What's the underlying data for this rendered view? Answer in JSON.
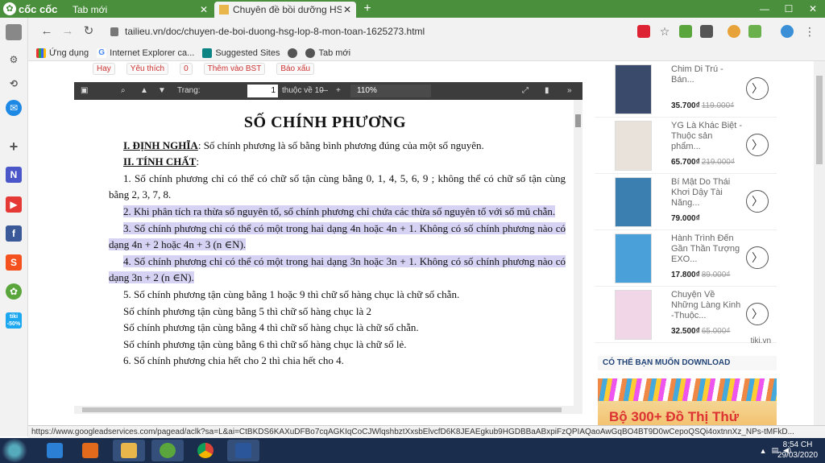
{
  "browser": {
    "brand": "cốc cốc",
    "tabs": [
      {
        "title": "Tab mới",
        "active": false
      },
      {
        "title": "Chuyên đề bồi dưỡng HSG lớp 8",
        "active": true
      }
    ],
    "new_tab": "+",
    "window_controls": {
      "minimize": "—",
      "maximize": "☐",
      "close": "✕"
    },
    "url": "tailieu.vn/doc/chuyen-de-boi-duong-hsg-lop-8-mon-toan-1625273.html",
    "bookmarks": [
      {
        "label": "Ứng dụng",
        "icon": "apps-grid-icon"
      },
      {
        "label": "Internet Explorer ca...",
        "icon": "google-icon"
      },
      {
        "label": "Suggested Sites",
        "icon": "bing-icon"
      },
      {
        "label": "",
        "icon": "globe-icon"
      },
      {
        "label": "Tab mới",
        "icon": "globe-icon"
      }
    ],
    "sidebar_icons": [
      "panel-icon",
      "settings-icon",
      "history-icon",
      "messenger-icon",
      "add-icon",
      "notion-icon",
      "youtube-icon",
      "facebook-icon",
      "shopee-icon",
      "coccoc-icon",
      "tiki-icon"
    ],
    "tiki_badge": "tiki\n-50%"
  },
  "page": {
    "social": [
      "Hay",
      "Yêu thích",
      "0",
      "Thêm vào BST",
      "Báo xấu"
    ],
    "pdf_toolbar": {
      "page_label": "Trang:",
      "page_value": "1",
      "page_of": "thuộc về 10",
      "zoom": "110%"
    },
    "doc": {
      "title": "SỐ CHÍNH PHƯƠNG",
      "def_label": "I. ĐỊNH NGHĨA",
      "def_text": ":  Số chính phương là số bằng bình phương đúng của một số nguyên.",
      "props_label": "II. TÍNH CHẤT",
      "props_colon": ":",
      "p1": "1. Số chính phương chỉ có thể có chữ số tận cùng bằng 0, 1, 4, 5, 6, 9 ; không thể có chữ số tận cùng bằng 2, 3, 7, 8.",
      "p2": "2. Khi phân tích ra thừa số nguyên tố, số chính phương chỉ chứa các thừa số nguyên tố với số mũ chẵn.",
      "p3": "3. Số chính phương chỉ có thể có một trong hai dạng 4n hoặc 4n + 1. Không có số chính phương nào có dạng 4n + 2 hoặc 4n + 3 (n ∈N).",
      "p4": "4. Số chính phương chỉ có thể có một trong hai dạng 3n hoặc 3n + 1. Không có số chính phương nào có dạng 3n + 2 (n ∈N).",
      "p5": "5. Số chính phương  tận cùng bằng 1 hoặc 9 thì chữ số hàng chục là chữ số chẵn.",
      "p5a": "Số chính phương tận cùng bằng 5 thì chữ số hàng chục là 2",
      "p5b": "Số chính phương tận cùng bằng 4 thì chữ số hàng chục là chữ số chẵn.",
      "p5c": "Số chính phương tận cùng bằng 6 thì chữ số hàng chục là chữ số lẻ.",
      "p6": "6. Số chính phương chia hết cho 2 thì chia hết cho 4."
    },
    "products": [
      {
        "name": "Chim Di Trú - Bán...",
        "price": "35.700₫",
        "old_price": "119.000₫",
        "color": "#3a4a6a"
      },
      {
        "name": "YG Là Khác Biệt -Thuộc sản phẩm...",
        "price": "65.700₫",
        "old_price": "219.000₫",
        "color": "#e8e2da"
      },
      {
        "name": "Bí Mật Do Thái Khơi Dậy Tài Năng...",
        "price": "79.000₫",
        "old_price": "",
        "color": "#3b7fb0"
      },
      {
        "name": "Hành Trình Đến Gần Thần Tượng EXO...",
        "price": "17.800₫",
        "old_price": "89.000₫",
        "color": "#4aa0d8"
      },
      {
        "name": "Chuyện Về Những Làng Kinh -Thuộc...",
        "price": "32.500₫",
        "old_price": "65.000₫",
        "color": "#f1d6e8"
      }
    ],
    "tiki_label": "tiki.vn",
    "download_heading": "CÓ THỂ BẠN MUỐN DOWNLOAD",
    "banner_text": "Bộ 300+ Đồ Thị Thử"
  },
  "status_url": "https://www.googleadservices.com/pagead/aclk?sa=L&ai=CtBKDS6KAXuDFBo7cqAGKIqCoCJWlqshbztXxsbElvcfD6K8JEAEgkub9HGDBBaABxpiFzQPIAQaoAwGqBO4BT9D0wCepoQSQi4oxtnnXz_NPs-tMFkD...",
  "taskbar": {
    "apps": [
      {
        "icon": "internet-explorer-icon",
        "color": "#2b7fd4"
      },
      {
        "icon": "media-player-icon",
        "color": "#e26a1c"
      },
      {
        "icon": "file-explorer-icon",
        "color": "#e8b64a"
      },
      {
        "icon": "coccoc-icon",
        "color": "#5aa63c"
      },
      {
        "icon": "chrome-icon",
        "color": "#db4437"
      },
      {
        "icon": "word-icon",
        "color": "#2b579a"
      }
    ],
    "time": "8:54 CH",
    "date": "29/03/2020"
  }
}
